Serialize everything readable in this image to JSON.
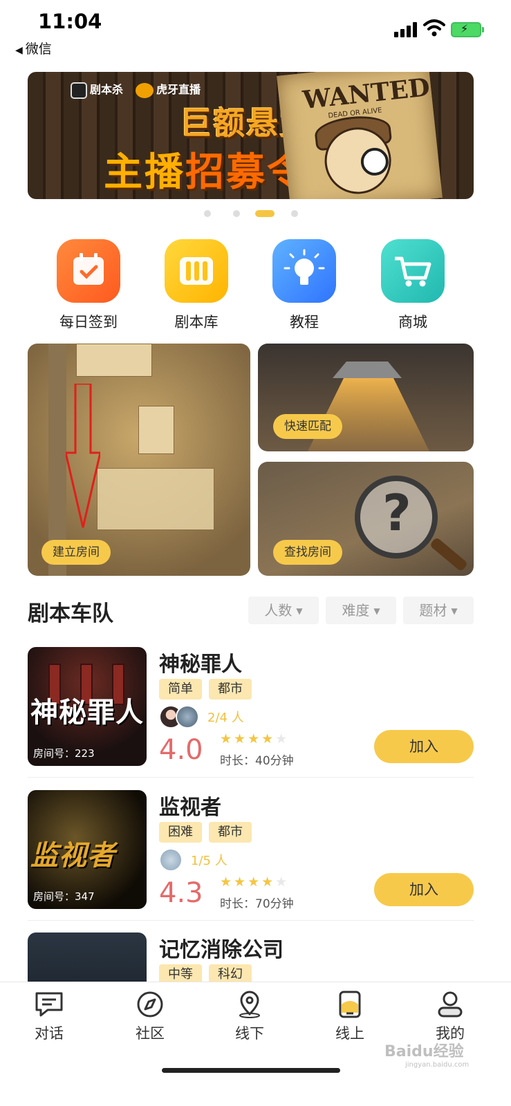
{
  "status_bar": {
    "time": "11:04",
    "back_label": "微信"
  },
  "banner": {
    "logo_left": "剧本杀",
    "logo_right": "虎牙直播",
    "headline_1": "巨额悬赏",
    "headline_2a": "主播",
    "headline_2b": "招募令",
    "poster_title": "WANTED",
    "poster_sub": "DEAD OR ALIVE",
    "active_slide": 3,
    "slide_count": 4
  },
  "quick_actions": [
    {
      "label": "每日签到",
      "icon": "calendar-check-icon"
    },
    {
      "label": "剧本库",
      "icon": "books-icon"
    },
    {
      "label": "教程",
      "icon": "lightbulb-icon"
    },
    {
      "label": "商城",
      "icon": "shopping-cart-icon"
    }
  ],
  "tiles": {
    "create_room": "建立房间",
    "quick_match": "快速匹配",
    "find_room": "查找房间"
  },
  "section": {
    "title": "剧本车队",
    "filters": [
      "人数",
      "难度",
      "题材"
    ]
  },
  "rooms": [
    {
      "name": "神秘罪人",
      "tags": [
        "简单",
        "都市"
      ],
      "players": "2/4 人",
      "rating": "4.0",
      "stars": 4,
      "duration": "时长：40分钟",
      "room_no": "房间号：223",
      "cover_text": "神秘罪人",
      "join_label": "加入"
    },
    {
      "name": "监视者",
      "tags": [
        "困难",
        "都市"
      ],
      "players": "1/5 人",
      "rating": "4.3",
      "stars": 4.3,
      "duration": "时长：70分钟",
      "room_no": "房间号：347",
      "cover_text": "监视者",
      "join_label": "加入"
    },
    {
      "name": "记忆消除公司",
      "tags": [
        "中等",
        "科幻"
      ]
    }
  ],
  "tabs": [
    {
      "label": "对话",
      "icon": "chat-icon"
    },
    {
      "label": "社区",
      "icon": "compass-icon"
    },
    {
      "label": "线下",
      "icon": "location-pin-icon"
    },
    {
      "label": "线上",
      "icon": "phone-icon"
    },
    {
      "label": "我的",
      "icon": "profile-icon"
    }
  ],
  "watermark": {
    "text": "Baidu经验",
    "url_text": "jingyan.baidu.com"
  },
  "colors": {
    "accent": "#f7c94b",
    "rating": "#e56a6a",
    "players": "#f0c040",
    "tag_bg": "#fce7b0"
  }
}
